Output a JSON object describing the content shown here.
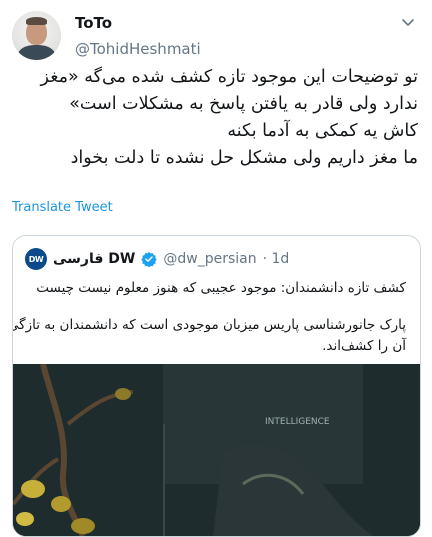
{
  "tweet": {
    "author": {
      "display_name": "ToTo",
      "handle": "@TohidHeshmati"
    },
    "text_lines": [
      "تو توضیحات این موجود تازه کشف شده می‌گه «مغز",
      "ندارد ولی قادر به یافتن پاسخ به مشکلات است»",
      "کاش یه کمکی به آدما بکنه",
      "ما مغز داریم ولی مشکل حل نشده تا دلت بخواد"
    ],
    "translate_label": "Translate Tweet"
  },
  "quoted_tweet": {
    "author": {
      "name": "فارسی DW",
      "handle": "@dw_persian",
      "time": "· 1d",
      "logo_text": "DW"
    },
    "text_lines": [
      "کشف تازه دانشمندان: موجود عجیبی که هنوز معلوم نیست چیست",
      "",
      "پارک جانورشناسی پاریس میزبان موجودی است که دانشمندان به تازگی",
      "آن را کشف‌اند."
    ],
    "media_caption": "INTELLIGENCE"
  },
  "icons": {
    "menu": "chevron-down-icon",
    "verified": "verified-badge-icon",
    "logo": "dw-logo-icon"
  },
  "colors": {
    "text": "#14171a",
    "secondary": "#657786",
    "link": "#1b95e0",
    "border": "#ccd6dd",
    "verified": "#1da1f2"
  }
}
